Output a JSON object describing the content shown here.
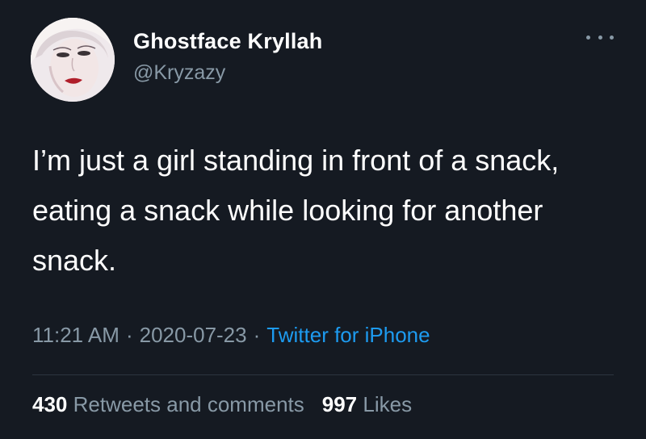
{
  "user": {
    "display_name": "Ghostface Kryllah",
    "handle": "@Kryzazy"
  },
  "tweet": {
    "text": "I’m just a girl standing in front of a snack, eating a snack while looking for another snack.",
    "time": "11:21 AM",
    "separator": "·",
    "date": "2020-07-23",
    "source": "Twitter for iPhone"
  },
  "stats": {
    "retweets_count": "430",
    "retweets_label": "Retweets and comments",
    "likes_count": "997",
    "likes_label": "Likes"
  },
  "icons": {
    "more": "more-options-icon",
    "avatar": "avatar-image"
  },
  "colors": {
    "background": "#151a22",
    "secondary_text": "#8899a6",
    "link": "#1d9bf0"
  }
}
